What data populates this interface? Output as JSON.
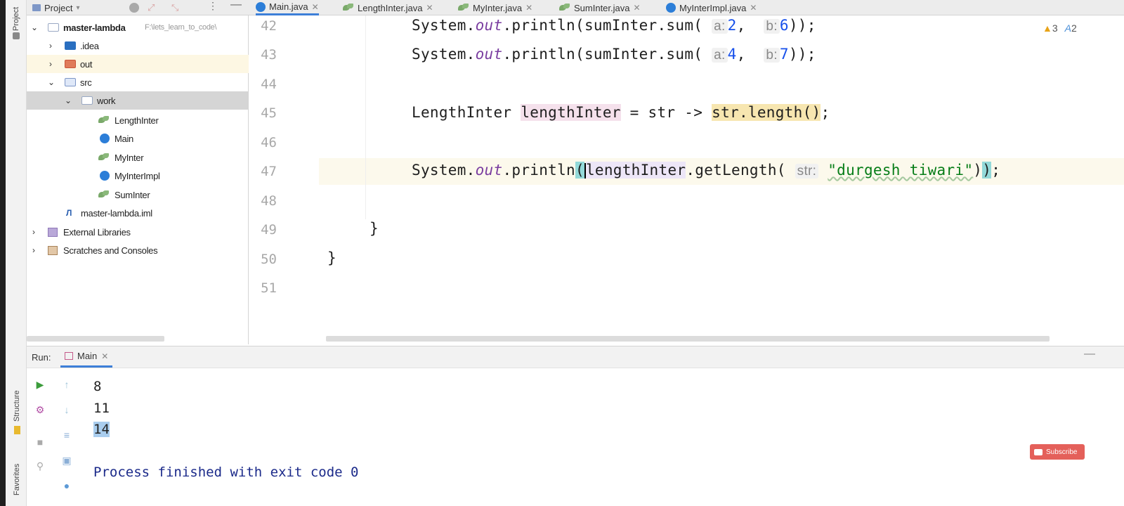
{
  "sidebar_strip": {
    "project_label": "Project",
    "structure_label": "Structure",
    "favorites_label": "Favorites"
  },
  "tabs": [
    {
      "label": "Main.java",
      "icon": "class-icon"
    },
    {
      "label": "LengthInter.java",
      "icon": "interface-icon"
    },
    {
      "label": "MyInter.java",
      "icon": "interface-icon"
    },
    {
      "label": "SumInter.java",
      "icon": "interface-icon"
    },
    {
      "label": "MyInterImpl.java",
      "icon": "class-icon"
    }
  ],
  "project_panel": {
    "title": "Project",
    "root": {
      "name": "master-lambda",
      "path": "F:\\lets_learn_to_code\\"
    },
    "items": [
      {
        "label": ".idea"
      },
      {
        "label": "out"
      },
      {
        "label": "src"
      },
      {
        "label": "work"
      },
      {
        "label": "LengthInter"
      },
      {
        "label": "Main"
      },
      {
        "label": "MyInter"
      },
      {
        "label": "MyInterImpl"
      },
      {
        "label": "SumInter"
      },
      {
        "label": "master-lambda.iml"
      },
      {
        "label": "External Libraries"
      },
      {
        "label": "Scratches and Consoles"
      }
    ]
  },
  "inspections": {
    "warnings": "3",
    "typos": "2"
  },
  "editor": {
    "line_numbers": [
      "42",
      "43",
      "44",
      "45",
      "46",
      "47",
      "48",
      "49",
      "50",
      "51"
    ],
    "line42": {
      "pre": "System.",
      "out": "out",
      "mid": ".println(sumInter.sum(",
      "hint_a": "a:",
      "val_a": "2",
      "comma": ",",
      "hint_b": "b:",
      "val_b": "6",
      "end": "));"
    },
    "line43": {
      "pre": "System.",
      "out": "out",
      "mid": ".println(sumInter.sum(",
      "hint_a": "a:",
      "val_a": "4",
      "comma": ",",
      "hint_b": "b:",
      "val_b": "7",
      "end": "));"
    },
    "line45": {
      "type": "LengthInter",
      "var": "lengthInter",
      "assign": " = str -> ",
      "body": "str.length()",
      "semi": ";"
    },
    "line47": {
      "pre": "System.",
      "out": "out",
      "mid": ".println",
      "open": "(",
      "var": "lengthInter",
      "call": ".getLength(",
      "hint": "str:",
      "str": "\"durgesh tiwari\"",
      "close1": ")",
      "close2": ")",
      "semi": ";"
    },
    "line49": "}",
    "line50": "}"
  },
  "run": {
    "label": "Run:",
    "tab": "Main"
  },
  "console": {
    "lines": [
      "8",
      "11",
      "14"
    ],
    "exit": "Process finished with exit code 0"
  },
  "subscribe": {
    "label": "Subscribe"
  }
}
